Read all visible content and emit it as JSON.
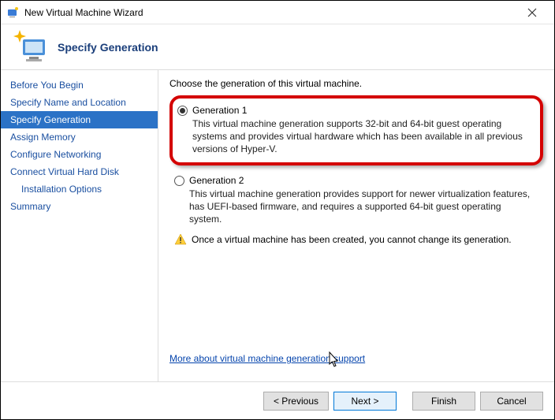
{
  "titlebar": {
    "title": "New Virtual Machine Wizard"
  },
  "header": {
    "title": "Specify Generation"
  },
  "sidebar": {
    "steps": [
      {
        "label": "Before You Begin",
        "active": false
      },
      {
        "label": "Specify Name and Location",
        "active": false
      },
      {
        "label": "Specify Generation",
        "active": true
      },
      {
        "label": "Assign Memory",
        "active": false
      },
      {
        "label": "Configure Networking",
        "active": false
      },
      {
        "label": "Connect Virtual Hard Disk",
        "active": false
      },
      {
        "label": "Installation Options",
        "active": false,
        "sub": true
      },
      {
        "label": "Summary",
        "active": false
      }
    ]
  },
  "main": {
    "prompt": "Choose the generation of this virtual machine.",
    "gen1": {
      "label": "Generation 1",
      "desc": "This virtual machine generation supports 32-bit and 64-bit guest operating systems and provides virtual hardware which has been available in all previous versions of Hyper-V."
    },
    "gen2": {
      "label": "Generation 2",
      "desc": "This virtual machine generation provides support for newer virtualization features, has UEFI-based firmware, and requires a supported 64-bit guest operating system."
    },
    "warning": "Once a virtual machine has been created, you cannot change its generation.",
    "link": "More about virtual machine generation support"
  },
  "footer": {
    "previous": "< Previous",
    "next": "Next >",
    "finish": "Finish",
    "cancel": "Cancel"
  }
}
